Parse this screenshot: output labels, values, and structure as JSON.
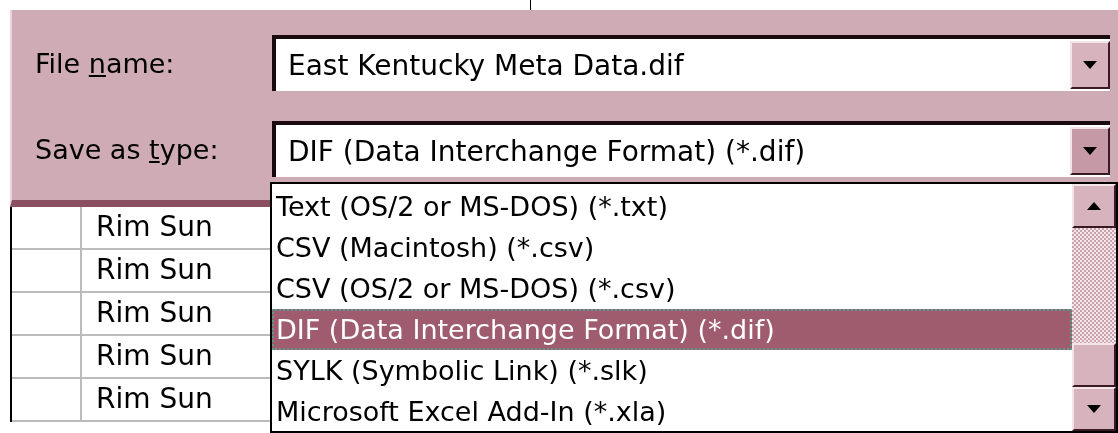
{
  "dialog": {
    "fields": [
      {
        "kind": "combo",
        "label_before": "File ",
        "mnemonic": "n",
        "label_after": "ame:",
        "value": "East Kentucky Meta Data.dif",
        "expanded": false
      },
      {
        "kind": "combo",
        "label_before": "Save as ",
        "mnemonic": "t",
        "label_after": "ype:",
        "value": "DIF (Data Interchange Format) (*.dif)",
        "expanded": true
      }
    ]
  },
  "type_list": {
    "items": [
      {
        "label": "Text (OS/2 or MS-DOS) (*.txt)",
        "selected": false
      },
      {
        "label": "CSV (Macintosh) (*.csv)",
        "selected": false
      },
      {
        "label": "CSV (OS/2 or MS-DOS) (*.csv)",
        "selected": false
      },
      {
        "label": "DIF (Data Interchange Format) (*.dif)",
        "selected": true
      },
      {
        "label": "SYLK (Symbolic Link) (*.slk)",
        "selected": false
      },
      {
        "label": "Microsoft Excel Add-In (*.xla)",
        "selected": false
      }
    ]
  },
  "sheet": {
    "rows": [
      {
        "cell": "Rim Sun"
      },
      {
        "cell": "Rim Sun"
      },
      {
        "cell": "Rim Sun"
      },
      {
        "cell": "Rim Sun"
      },
      {
        "cell": "Rim Sun"
      }
    ]
  }
}
